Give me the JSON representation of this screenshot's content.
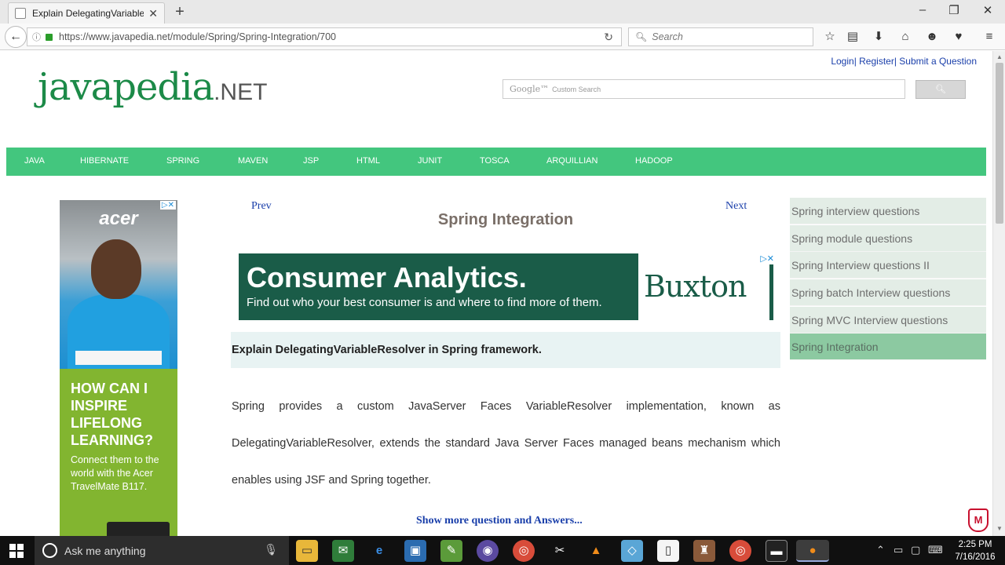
{
  "browser": {
    "tab_title": "Explain DelegatingVariable...",
    "url": "https://www.javapedia.net/module/Spring/Spring-Integration/700",
    "search_placeholder": "Search"
  },
  "header": {
    "top_links": "Login| Register| Submit a Question",
    "logo_main": "javapedia",
    "logo_suffix": ".NET",
    "search_brand": "Google™",
    "search_placeholder": "Custom Search"
  },
  "nav": {
    "items": [
      "JAVA",
      "HIBERNATE",
      "SPRING",
      "MAVEN",
      "JSP",
      "HTML",
      "JUNIT",
      "TOSCA",
      "ARQUILLIAN",
      "HADOOP"
    ]
  },
  "left_ad": {
    "brand": "acer",
    "headline": "HOW CAN I INSPIRE LIFELONG LEARNING?",
    "body": "Connect them to the world with the Acer TravelMate B117."
  },
  "article": {
    "prev": "Prev",
    "next": "Next",
    "title": "Spring Integration",
    "question": "Explain DelegatingVariableResolver in Spring framework.",
    "answer": "Spring provides a custom JavaServer Faces VariableResolver implementation, known as DelegatingVariableResolver, extends the standard Java Server Faces managed beans mechanism which enables using JSF and Spring together.",
    "show_more": "Show more question and Answers..."
  },
  "mid_ad": {
    "headline": "Consumer Analytics.",
    "subline": "Find out who your best consumer is and where to find more of them.",
    "brand": "Buxton"
  },
  "sidebar": {
    "items": [
      {
        "label": "Spring interview questions",
        "active": false
      },
      {
        "label": "Spring module questions",
        "active": false
      },
      {
        "label": "Spring Interview questions II",
        "active": false
      },
      {
        "label": "Spring batch Interview questions",
        "active": false
      },
      {
        "label": "Spring MVC Interview questions",
        "active": false
      },
      {
        "label": "Spring Integration",
        "active": true
      }
    ]
  },
  "taskbar": {
    "search_text": "Ask me anything",
    "time": "2:25 PM",
    "date": "7/16/2016"
  },
  "colors": {
    "menu_green": "#43c67e",
    "link_blue": "#1a3faa",
    "logo_green": "#1c8a48"
  }
}
